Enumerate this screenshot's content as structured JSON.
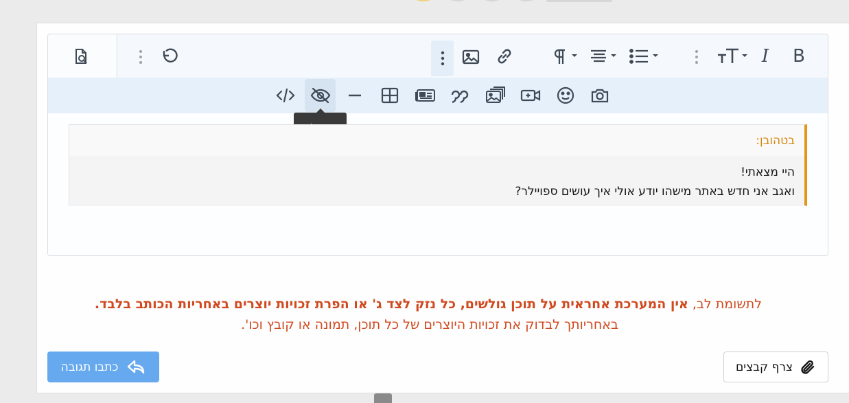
{
  "toolbar": {
    "bold_label": "B",
    "italic_label": "I",
    "preview_tooltip": "ספוילר"
  },
  "quote": {
    "author": "בטהובן:",
    "lines": [
      "היי מצאתי!",
      "ואגב אני חדש באתר מישהו יודע אולי איך עושים ספויילר?"
    ]
  },
  "notice": {
    "line1_prefix": "לתשומת לב,",
    "line1_bold": "אין המערכת אחראית על תוכן גולשים, כל נזק לצד ג' או הפרת זכויות יוצרים באחריות הכותב בלבד",
    "line1_suffix": ".",
    "line2": "באחריותך לבדוק את זכויות היוצרים של כל תוכן, תמונה או קובץ וכו'."
  },
  "buttons": {
    "reply_label": "כתבו תגובה",
    "attach_label": "צרף קבצים"
  },
  "colors": {
    "accent_blue": "#67a9ee",
    "notice_red": "#d0491f",
    "quote_orange": "#e59516"
  }
}
